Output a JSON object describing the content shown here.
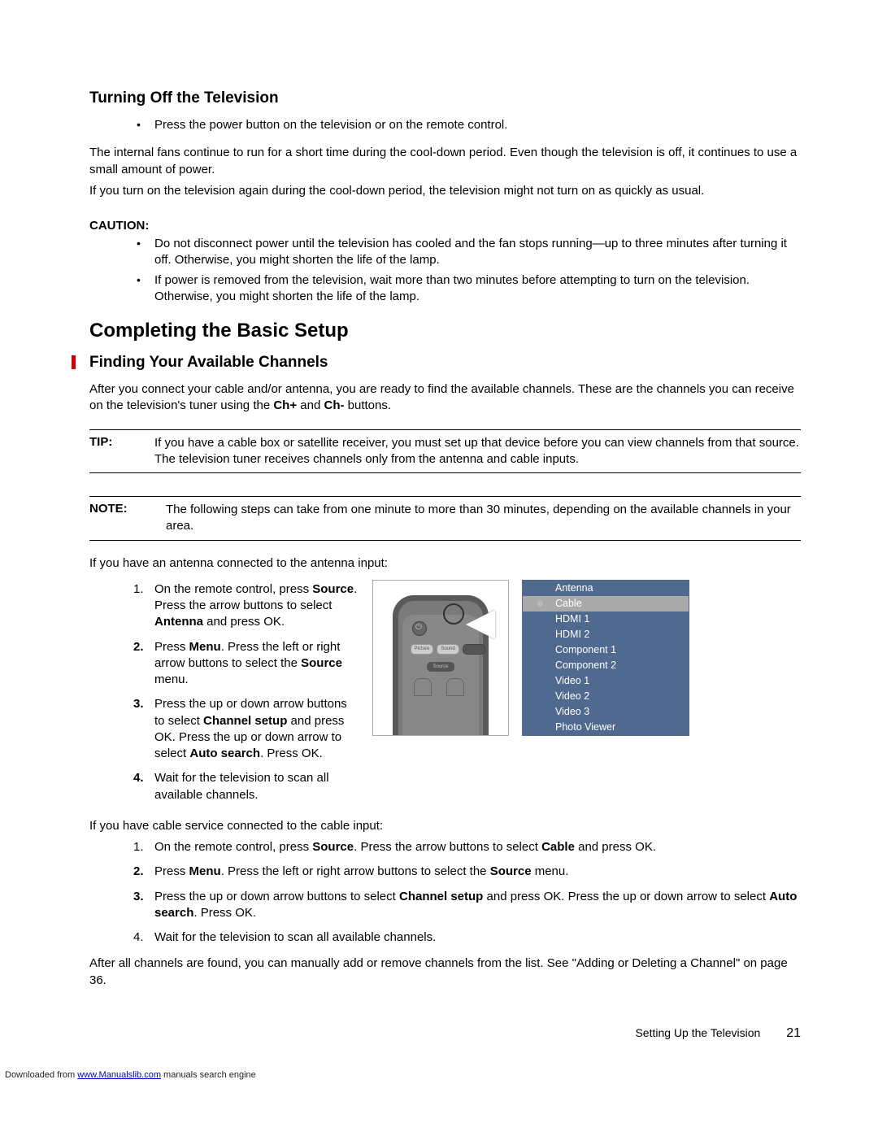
{
  "section1": {
    "title": "Turning Off the Television",
    "bullet": "Press the power button on the television or on the remote control.",
    "para1": "The internal fans continue to run for a short time during the cool-down period. Even though the television is off, it continues to use a small amount of power.",
    "para2": "If you turn on the television again during the cool-down period, the television might not turn on as quickly as usual."
  },
  "caution": {
    "label": "CAUTION:",
    "items": [
      "Do not disconnect power until the television has cooled and the fan stops running—up to three minutes after turning it off. Otherwise, you might shorten the life of the lamp.",
      "If power is removed from the television, wait more than two minutes before attempting to turn on the television. Otherwise, you might shorten the life of the lamp."
    ]
  },
  "section2": {
    "title": "Completing the Basic Setup",
    "sub": "Finding Your Available Channels",
    "intro_a": "After you connect your cable and/or antenna, you are ready to find the available channels. These are the channels you can receive on the television's tuner using the ",
    "intro_b1": "Ch+",
    "intro_mid": " and ",
    "intro_b2": "Ch-",
    "intro_c": " buttons."
  },
  "tip": {
    "label": "TIP:",
    "text": "If you have a cable box or satellite receiver, you must set up that device before you can view channels from that source. The television tuner receives channels only from the antenna and cable inputs."
  },
  "note": {
    "label": "NOTE:",
    "text": "The following steps can take from one minute to more than 30 minutes, depending on the available channels in your area."
  },
  "antenna_lead": "If you have an antenna connected to the antenna input:",
  "ant_steps": {
    "s1a": "On the remote control, press ",
    "s1b": "Source",
    "s1c": ". Press the arrow buttons to select ",
    "s1d": "Antenna",
    "s1e": " and press OK.",
    "s2a": "Press ",
    "s2b": "Menu",
    "s2c": ". Press the left or right arrow buttons to select the ",
    "s2d": "Source",
    "s2e": " menu.",
    "s3a": "Press the up or down arrow buttons to select ",
    "s3b": "Channel setup",
    "s3c": " and press OK. Press the up or down arrow to select ",
    "s3d": "Auto search",
    "s3e": ". Press OK.",
    "s4": "Wait for the television to scan all available channels."
  },
  "source_menu": [
    "Antenna",
    "Cable",
    "HDMI 1",
    "HDMI 2",
    "Component 1",
    "Component 2",
    "Video 1",
    "Video 2",
    "Video 3",
    "Photo Viewer"
  ],
  "cable_lead": "If you have cable service connected to the cable input:",
  "cab_steps": {
    "s1a": "On the remote control, press ",
    "s1b": "Source",
    "s1c": ". Press the arrow buttons to select ",
    "s1d": "Cable",
    "s1e": " and press OK.",
    "s2a": "Press ",
    "s2b": "Menu",
    "s2c": ". Press the left or right arrow buttons to select the ",
    "s2d": "Source",
    "s2e": " menu.",
    "s3a": "Press the up or down arrow buttons to select ",
    "s3b": "Channel setup",
    "s3c": " and press OK. Press the up or down arrow to select ",
    "s3d": "Auto search",
    "s3e": ". Press OK.",
    "s4": "Wait for the television to scan all available channels."
  },
  "after_all": "After all channels are found, you can manually add or remove channels from the list. See \"Adding or Deleting a Channel\" on page 36.",
  "footer": {
    "section": "Setting Up the Television",
    "page": "21"
  },
  "download": {
    "prefix": "Downloaded from ",
    "link": "www.Manualslib.com",
    "suffix": " manuals search engine"
  }
}
